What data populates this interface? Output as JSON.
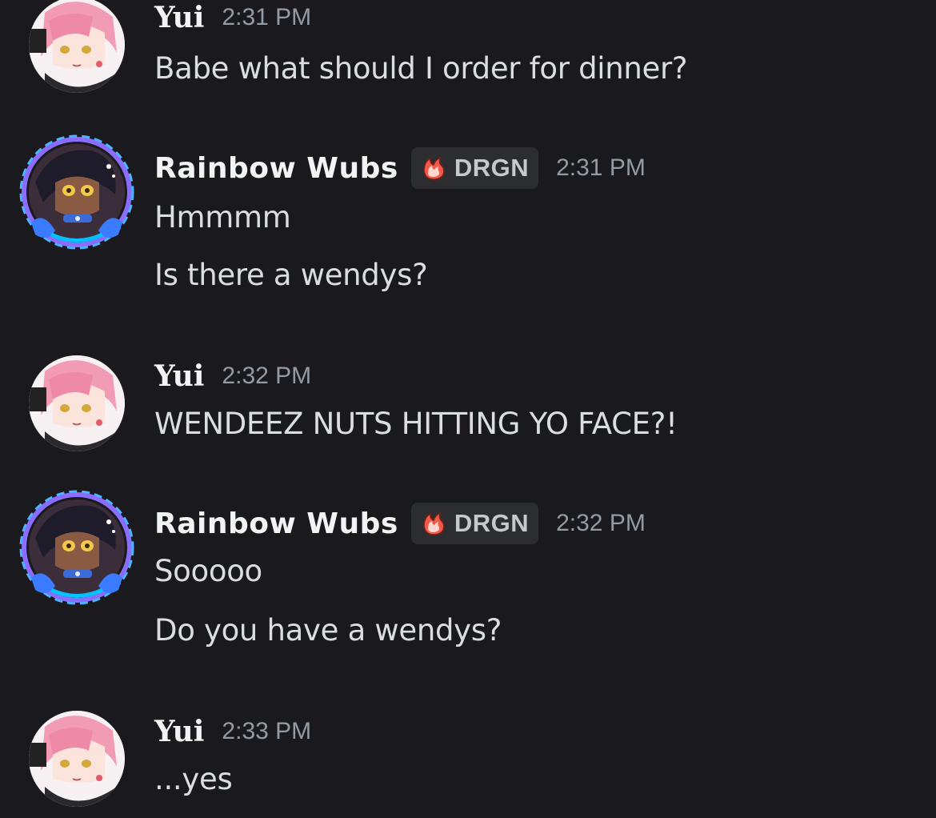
{
  "messages": [
    {
      "author": "Yui",
      "time": "2:31 PM",
      "lines": [
        "Babe what should I order for dinner?"
      ]
    },
    {
      "author": "Rainbow Wubs",
      "tag": "DRGN",
      "time": "2:31 PM",
      "lines": [
        "Hmmmm",
        "Is there a wendys?"
      ]
    },
    {
      "author": "Yui",
      "time": "2:32 PM",
      "lines": [
        "WENDEEZ NUTS HITTING YO FACE?!"
      ]
    },
    {
      "author": "Rainbow Wubs",
      "tag": "DRGN",
      "time": "2:32 PM",
      "lines": [
        "Sooooo",
        "Do you have a wendys?"
      ]
    },
    {
      "author": "Yui",
      "time": "2:33 PM",
      "lines": [
        "...yes"
      ]
    }
  ],
  "colors": {
    "background": "#1a1a1e",
    "username": "#f2f3f5",
    "timestamp": "#949ba4",
    "message_text": "#dbdee1",
    "tag_background": "#2b2d31"
  },
  "icons": {
    "tag_icon": "flame-icon"
  }
}
